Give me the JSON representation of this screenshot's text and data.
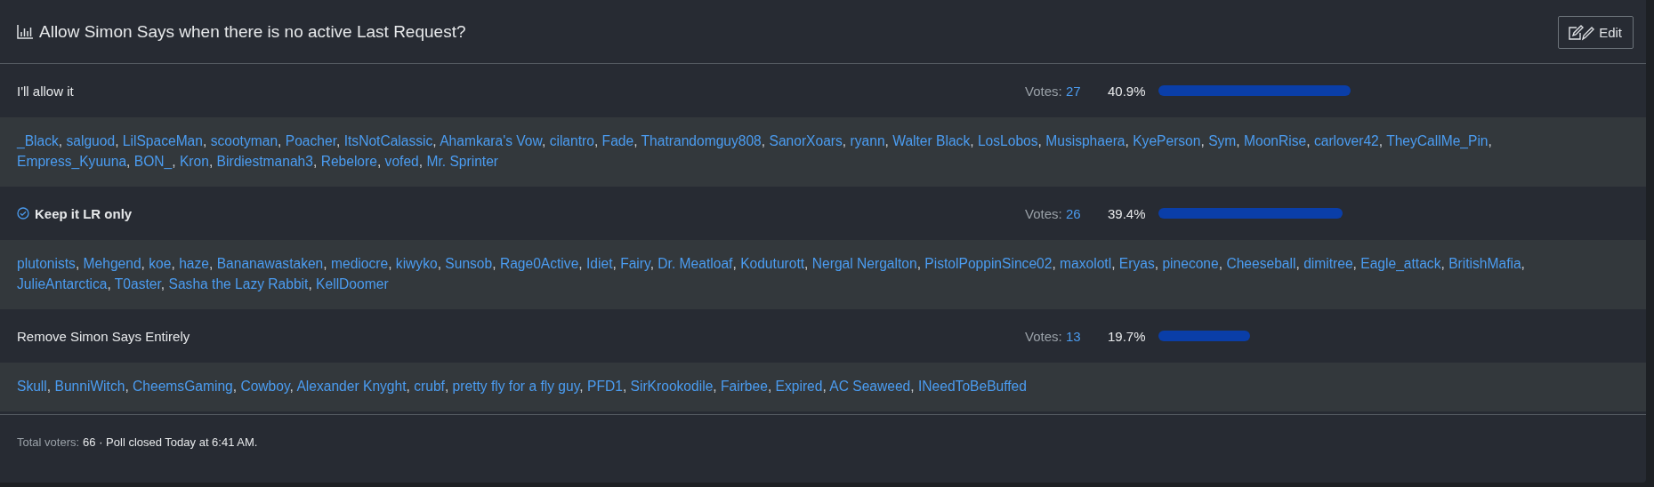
{
  "poll": {
    "title": "Allow Simon Says when there is no active Last Request?",
    "edit_button": "Edit"
  },
  "options": [
    {
      "label": "I'll allow it",
      "voted": false,
      "votes_label": "Votes:",
      "votes": "27",
      "percent": "40.9%",
      "voters": [
        {
          "name": "_Black",
          "sep": ","
        },
        {
          "name": "salguod",
          "sep": ","
        },
        {
          "name": "LilSpaceMan",
          "sep": ","
        },
        {
          "name": "scootyman",
          "sep": ","
        },
        {
          "name": "Poacher",
          "sep": ","
        },
        {
          "name": "ItsNotCalassic",
          "sep": ","
        },
        {
          "name": "Ahamkara's Vow",
          "sep": ","
        },
        {
          "name": "cilantro",
          "sep": ","
        },
        {
          "name": "Fade",
          "sep": ","
        },
        {
          "name": "Thatrandomguy808",
          "sep": ","
        },
        {
          "name": "SanorXoars",
          "sep": ","
        },
        {
          "name": "ryann",
          "sep": ","
        },
        {
          "name": "Walter Black",
          "sep": ","
        },
        {
          "name": "LosLobos",
          "sep": ","
        },
        {
          "name": "Musisphaera",
          "sep": ","
        },
        {
          "name": "KyePerson",
          "sep": ","
        },
        {
          "name": "Sym",
          "sep": ","
        },
        {
          "name": "MoonRise",
          "sep": ","
        },
        {
          "name": "carlover42",
          "sep": ","
        },
        {
          "name": "TheyCallMe_Pin",
          "sep": ","
        },
        {
          "name": "Empress_Kyuuna",
          "sep": ","
        },
        {
          "name": "BON_",
          "sep": ","
        },
        {
          "name": "Kron",
          "sep": ","
        },
        {
          "name": "Birdiestmanah3",
          "sep": ","
        },
        {
          "name": "Rebelore",
          "sep": ","
        },
        {
          "name": "vofed",
          "sep": ","
        },
        {
          "name": "Mr. Sprinter"
        }
      ]
    },
    {
      "label": "Keep it LR only",
      "voted": true,
      "votes_label": "Votes:",
      "votes": "26",
      "percent": "39.4%",
      "voters": [
        {
          "name": "plutonists",
          "sep": ","
        },
        {
          "name": "Mehgend",
          "sep": ","
        },
        {
          "name": "koe",
          "sep": ","
        },
        {
          "name": "haze",
          "sep": ","
        },
        {
          "name": "Bananawastaken",
          "sep": ","
        },
        {
          "name": "mediocre",
          "sep": ","
        },
        {
          "name": "kiwyko",
          "sep": ","
        },
        {
          "name": "Sunsob",
          "sep": ","
        },
        {
          "name": "Rage0Active",
          "sep": ","
        },
        {
          "name": "Idiet",
          "sep": ","
        },
        {
          "name": "Fairy",
          "sep": ","
        },
        {
          "name": "Dr. Meatloaf",
          "sep": ","
        },
        {
          "name": "Koduturott",
          "sep": ","
        },
        {
          "name": "Nergal Nergalton",
          "sep": ","
        },
        {
          "name": "PistolPoppinSince02",
          "sep": ","
        },
        {
          "name": "maxolotl",
          "sep": ","
        },
        {
          "name": "Eryas",
          "sep": ","
        },
        {
          "name": "pinecone",
          "sep": ","
        },
        {
          "name": "Cheeseball",
          "sep": ","
        },
        {
          "name": "dimitree",
          "sep": ","
        },
        {
          "name": "Eagle_attack",
          "sep": ","
        },
        {
          "name": "BritishMafia",
          "sep": ","
        },
        {
          "name": "JulieAntarctica",
          "sep": ","
        },
        {
          "name": "T0aster",
          "sep": ","
        },
        {
          "name": "Sasha the Lazy Rabbit",
          "sep": ","
        },
        {
          "name": "KellDoomer"
        }
      ]
    },
    {
      "label": "Remove Simon Says Entirely",
      "voted": false,
      "votes_label": "Votes:",
      "votes": "13",
      "percent": "19.7%",
      "voters": [
        {
          "name": "Skull",
          "sep": ","
        },
        {
          "name": "BunniWitch",
          "sep": ","
        },
        {
          "name": "CheemsGaming",
          "sep": ","
        },
        {
          "name": "Cowboy",
          "sep": ","
        },
        {
          "name": "Alexander Knyght",
          "sep": ","
        },
        {
          "name": "crubf",
          "sep": ","
        },
        {
          "name": "pretty fly for a fly guy",
          "sep": ","
        },
        {
          "name": "PFD1",
          "sep": ","
        },
        {
          "name": "SirKrookodile",
          "sep": ","
        },
        {
          "name": "Fairbee",
          "sep": ","
        },
        {
          "name": "Expired",
          "sep": ","
        },
        {
          "name": "AC Seaweed",
          "sep": ","
        },
        {
          "name": "INeedToBeBuffed"
        }
      ]
    }
  ],
  "footer": {
    "label": "Total voters:",
    "value": "66 · Poll closed Today at 6:41 AM."
  }
}
